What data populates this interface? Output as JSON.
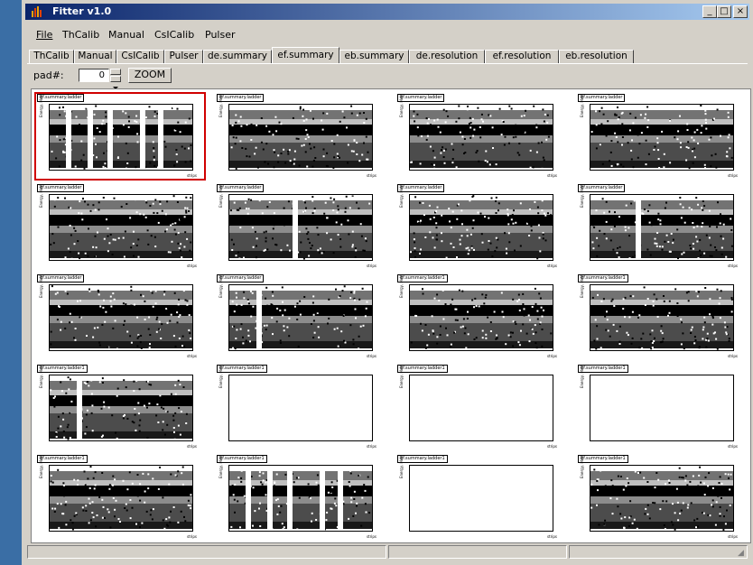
{
  "window": {
    "title": "Fitter v1.0",
    "minimize": "_",
    "maximize": "□",
    "close": "×"
  },
  "menu": [
    {
      "label": "File",
      "underline": true
    },
    {
      "label": "ThCalib"
    },
    {
      "label": "Manual"
    },
    {
      "label": "CsICalib"
    },
    {
      "label": "Pulser"
    }
  ],
  "tabs": [
    "ThCalib",
    "Manual",
    "CsICalib",
    "Pulser",
    "de.summary",
    "ef.summary",
    "eb.summary",
    "de.resolution",
    "ef.resolution",
    "eb.resolution"
  ],
  "active_tab": "ef.summary",
  "toolbar": {
    "pad_label": "pad#:",
    "pad_value": "0",
    "zoom_label": "ZOOM"
  },
  "pads": [
    {
      "title": "ef.summary.ladder",
      "fill": "full-gaps",
      "selected": true
    },
    {
      "title": "ef.summary.ladder",
      "fill": "full"
    },
    {
      "title": "ef.summary.ladder",
      "fill": "full"
    },
    {
      "title": "ef.summary.ladder",
      "fill": "full"
    },
    {
      "title": "ef.summary.ladder",
      "fill": "full"
    },
    {
      "title": "ef.summary.ladder",
      "fill": "full-gap"
    },
    {
      "title": "ef.summary.ladder",
      "fill": "full"
    },
    {
      "title": "ef.summary.ladder",
      "fill": "full-gap"
    },
    {
      "title": "ef.summary.ladder",
      "fill": "full"
    },
    {
      "title": "ef.summary.ladder",
      "fill": "full-gap"
    },
    {
      "title": "ef.summary.ladder1",
      "fill": "full"
    },
    {
      "title": "ef.summary.ladder1",
      "fill": "full"
    },
    {
      "title": "ef.summary.ladder1",
      "fill": "full-gap"
    },
    {
      "title": "ef.summary.ladder1",
      "fill": "empty"
    },
    {
      "title": "ef.summary.ladder1",
      "fill": "empty"
    },
    {
      "title": "ef.summary.ladder1",
      "fill": "empty"
    },
    {
      "title": "ef.summary.ladder1",
      "fill": "full"
    },
    {
      "title": "ef.summary.ladder1",
      "fill": "full-gaps"
    },
    {
      "title": "ef.summary.ladder1",
      "fill": "empty"
    },
    {
      "title": "ef.summary.ladder1",
      "fill": "full"
    }
  ],
  "pad_axis": {
    "y": "Energy, MeV",
    "x": "strips"
  }
}
